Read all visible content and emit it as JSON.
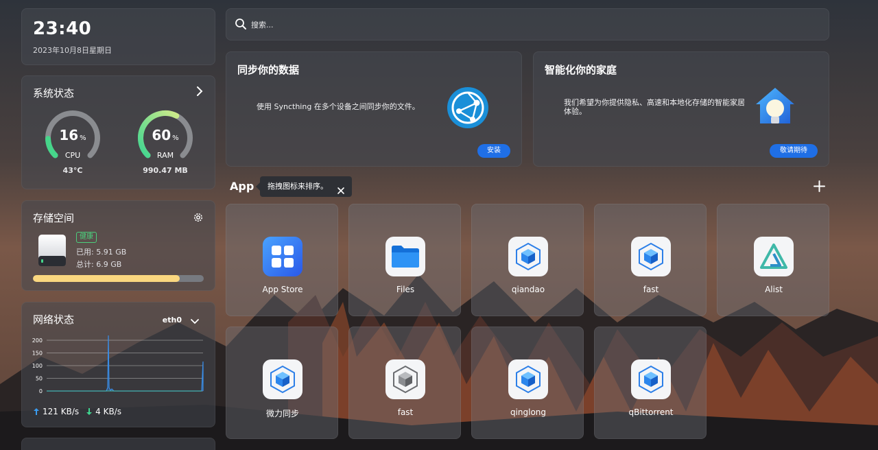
{
  "clock": {
    "time": "23:40",
    "date": "2023年10月8日星期日"
  },
  "system": {
    "title": "系统状态",
    "cpu": {
      "percent": "16",
      "percent_value": 16,
      "unit": "%",
      "label": "CPU",
      "sub": "43°C"
    },
    "ram": {
      "percent": "60",
      "percent_value": 60,
      "unit": "%",
      "label": "RAM",
      "sub": "990.47 MB"
    }
  },
  "storage": {
    "title": "存储空间",
    "health": "健康",
    "used": "已用: 5.91 GB",
    "total": "总计: 6.9 GB",
    "used_fraction": 0.86
  },
  "network": {
    "title": "网络状态",
    "interface": "eth0",
    "y_ticks": [
      "200",
      "150",
      "100",
      "50",
      "0"
    ],
    "upload": "121 KB/s",
    "download": "4 KB/s"
  },
  "search": {
    "placeholder": "搜索..."
  },
  "promos": [
    {
      "title": "同步你的数据",
      "description": "使用 Syncthing 在多个设备之间同步你的文件。",
      "button": "安装"
    },
    {
      "title": "智能化你的家庭",
      "description": "我们希望为你提供隐私、高速和本地化存储的智能家居体验。",
      "button": "敬请期待"
    }
  ],
  "apps_section": {
    "title": "App",
    "tooltip": "拖拽图标来排序。"
  },
  "apps": [
    {
      "name": "App Store",
      "icon": "app-store-icon"
    },
    {
      "name": "Files",
      "icon": "folder-icon"
    },
    {
      "name": "qiandao",
      "icon": "blue-cube-icon"
    },
    {
      "name": "fast",
      "icon": "blue-cube-icon"
    },
    {
      "name": "Alist",
      "icon": "alist-icon"
    },
    {
      "name": "微力同步",
      "icon": "blue-cube-icon"
    },
    {
      "name": "fast",
      "icon": "gray-cube-icon"
    },
    {
      "name": "qinglong",
      "icon": "blue-cube-icon"
    },
    {
      "name": "qBittorrent",
      "icon": "blue-cube-icon"
    }
  ],
  "colors": {
    "accent": "#1f6fe6",
    "healthy": "#4cd07d",
    "storage_bar": "#fad77f",
    "gauge_green": "#46d58a"
  }
}
